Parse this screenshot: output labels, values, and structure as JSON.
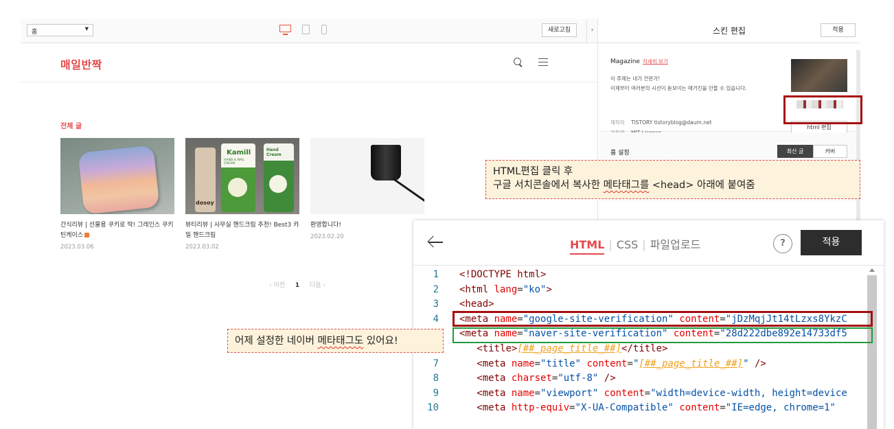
{
  "preview": {
    "page_select": "홈",
    "refresh_label": "새로고침",
    "collapse_glyph": "›",
    "blog_title": "매일반짝",
    "section_label": "전체 글",
    "posts": [
      {
        "title": "간식리뷰 | 선물용 쿠키로 딱! 그레인스 쿠키 틴케이스",
        "date": "2023.03.06"
      },
      {
        "title": "뷰티리뷰 | 사무실 핸드크림 추천! Best3 카밀 핸드크림",
        "date": "2023.03.02"
      },
      {
        "title": "환영합니다!",
        "date": "2023.02.20"
      }
    ],
    "pager": {
      "prev": "‹ 이전",
      "current": "1",
      "next": "다음 ›"
    },
    "thumb_text": {
      "tube1_brand": "Kamill",
      "tube1_sub": "HAND & NAIL CREAM",
      "tube2_brand": "Hand Cream",
      "tube3_brand": "dosoy"
    }
  },
  "skin_panel": {
    "title": "스킨 편집",
    "apply_label": "적용",
    "skin_name": "Magazine",
    "detail_link": "자세히 보기",
    "desc_line1": "이 주제는 내가 전문가!",
    "desc_line2": "이제부터 여러분의 시선이 돋보이는 매거진을 만들 수 있습니다.",
    "maker_key": "제작자",
    "maker_value": "TISTORY tistoryblog@daum.net",
    "license_key": "저작권",
    "license_value": "MIT License",
    "html_edit_label": "html 편집",
    "home_settings_label": "홈 설정",
    "home_mode_active": "최신 글",
    "home_mode_inactive": "커버"
  },
  "callouts": {
    "callout1_line1": "HTML편집 클릭 후",
    "callout1_line2_a": "구글 서치콘솔에서 복사한 ",
    "callout1_line2_b": "메타태그를",
    "callout1_line2_c": " <head> 아래에 붙여줌",
    "callout2_a": "어제 설정한 네이버 ",
    "callout2_b": "메타태그도",
    "callout2_c": " 있어요!"
  },
  "editor": {
    "tabs": [
      "HTML",
      "CSS",
      "파일업로드"
    ],
    "tab_sep": "|",
    "help_glyph": "?",
    "apply_label": "적용",
    "code_lines": [
      {
        "n": "1",
        "parts": [
          [
            "doctype",
            "<!DOCTYPE html>"
          ]
        ]
      },
      {
        "n": "2",
        "parts": [
          [
            "tag",
            "<html "
          ],
          [
            "attr",
            "lang"
          ],
          [
            "punc",
            "="
          ],
          [
            "val",
            "\"ko\""
          ],
          [
            "tag",
            ">"
          ]
        ]
      },
      {
        "n": "3",
        "parts": [
          [
            "tag",
            "<head>"
          ]
        ]
      },
      {
        "n": "4",
        "parts": [
          [
            "tag",
            "<meta "
          ],
          [
            "attr",
            "name"
          ],
          [
            "punc",
            "="
          ],
          [
            "val",
            "\"google-site-verification\""
          ],
          [
            "punc",
            " "
          ],
          [
            "attr",
            "content"
          ],
          [
            "punc",
            "="
          ],
          [
            "val",
            "\"jDzMqjJt14tLzxs8YkzC"
          ]
        ]
      },
      {
        "n": "",
        "parts": [
          [
            "tag",
            "<meta "
          ],
          [
            "attr",
            "name"
          ],
          [
            "punc",
            "="
          ],
          [
            "val",
            "\"naver-site-verification\""
          ],
          [
            "punc",
            " "
          ],
          [
            "attr",
            "content"
          ],
          [
            "punc",
            "="
          ],
          [
            "val",
            "\"28d222dbe892e14733df5"
          ]
        ]
      },
      {
        "n": "",
        "parts": [
          [
            "punc",
            "   "
          ],
          [
            "tag",
            "<title>"
          ],
          [
            "ital",
            "[##_page_title_##]"
          ],
          [
            "tag",
            "</title>"
          ]
        ]
      },
      {
        "n": "7",
        "parts": [
          [
            "punc",
            "   "
          ],
          [
            "tag",
            "<meta "
          ],
          [
            "attr",
            "name"
          ],
          [
            "punc",
            "="
          ],
          [
            "val",
            "\"title\""
          ],
          [
            "punc",
            " "
          ],
          [
            "attr",
            "content"
          ],
          [
            "punc",
            "="
          ],
          [
            "val",
            "\""
          ],
          [
            "ital",
            "[##_page_title_##]"
          ],
          [
            "val",
            "\""
          ],
          [
            "tag",
            " />"
          ]
        ]
      },
      {
        "n": "8",
        "parts": [
          [
            "punc",
            "   "
          ],
          [
            "tag",
            "<meta "
          ],
          [
            "attr",
            "charset"
          ],
          [
            "punc",
            "="
          ],
          [
            "val",
            "\"utf-8\""
          ],
          [
            "tag",
            " />"
          ]
        ]
      },
      {
        "n": "9",
        "parts": [
          [
            "punc",
            "   "
          ],
          [
            "tag",
            "<meta "
          ],
          [
            "attr",
            "name"
          ],
          [
            "punc",
            "="
          ],
          [
            "val",
            "\"viewport\""
          ],
          [
            "punc",
            " "
          ],
          [
            "attr",
            "content"
          ],
          [
            "punc",
            "="
          ],
          [
            "val",
            "\"width=device-width, height=device"
          ]
        ]
      },
      {
        "n": "10",
        "parts": [
          [
            "punc",
            "   "
          ],
          [
            "tag",
            "<meta "
          ],
          [
            "attr",
            "http-equiv"
          ],
          [
            "punc",
            "="
          ],
          [
            "val",
            "\"X-UA-Compatible\""
          ],
          [
            "punc",
            " "
          ],
          [
            "attr",
            "content"
          ],
          [
            "punc",
            "="
          ],
          [
            "val",
            "\"IE=edge, chrome=1\""
          ]
        ]
      }
    ]
  },
  "colors": {
    "accent": "#e5494c",
    "highlight_red": "#a50e0e",
    "highlight_green": "#1f9a3a",
    "callout_bg": "#fdf2db"
  }
}
